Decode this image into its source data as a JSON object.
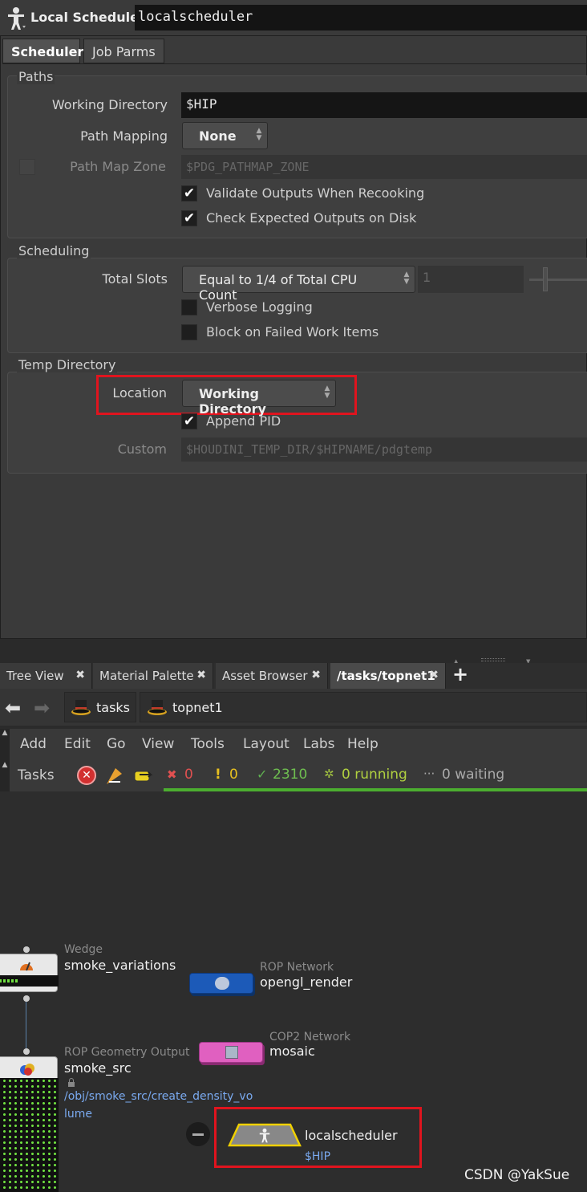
{
  "header": {
    "title": "Local Scheduler",
    "node_name": "localscheduler"
  },
  "tabs": [
    "Scheduler",
    "Job Parms"
  ],
  "paths": {
    "group": "Paths",
    "working_dir_label": "Working Directory",
    "working_dir_value": "$HIP",
    "path_mapping_label": "Path Mapping",
    "path_mapping_value": "None",
    "path_map_zone_label": "Path Map Zone",
    "path_map_zone_value": "$PDG_PATHMAP_ZONE",
    "validate_label": "Validate Outputs When Recooking",
    "check_label": "Check Expected Outputs on Disk",
    "check_mark": "✔"
  },
  "scheduling": {
    "group": "Scheduling",
    "total_slots_label": "Total Slots",
    "total_slots_value": "Equal to 1/4 of Total CPU Count",
    "slots_number": "1",
    "verbose_label": "Verbose Logging",
    "block_label": "Block on Failed Work Items"
  },
  "temp": {
    "group": "Temp Directory",
    "location_label": "Location",
    "location_value": "Working Directory",
    "append_pid_label": "Append PID",
    "custom_label": "Custom",
    "custom_value": "$HOUDINI_TEMP_DIR/$HIPNAME/pdgtemp"
  },
  "pane_tabs": [
    {
      "label": "Tree View"
    },
    {
      "label": "Material Palette"
    },
    {
      "label": "Asset Browser"
    },
    {
      "label": "/tasks/topnet1"
    }
  ],
  "close_glyph": "✖",
  "add_tab": "+",
  "breadcrumb": [
    "tasks",
    "topnet1"
  ],
  "menu": [
    "Add",
    "Edit",
    "Go",
    "View",
    "Tools",
    "Layout",
    "Labs",
    "Help"
  ],
  "tasks": {
    "label": "Tasks",
    "failed": "0",
    "warnings": "0",
    "done": "2310",
    "running": "0 running",
    "waiting": "0 waiting",
    "x": "✖",
    "excl": "!",
    "check": "✓",
    "spin": "✲",
    "dots": "···"
  },
  "nodes": {
    "wedge": {
      "type": "Wedge",
      "name": "smoke_variations"
    },
    "rop_net": {
      "type": "ROP Network",
      "name": "opengl_render"
    },
    "rop_geo": {
      "type": "ROP Geometry Output",
      "name": "smoke_src",
      "path1": "/obj/smoke_src/create_density_vo",
      "path2": "lume"
    },
    "cop2": {
      "type": "COP2 Network",
      "name": "mosaic"
    },
    "sched": {
      "name": "localscheduler",
      "sub": "$HIP"
    }
  },
  "watermark": "CSDN @YakSue"
}
